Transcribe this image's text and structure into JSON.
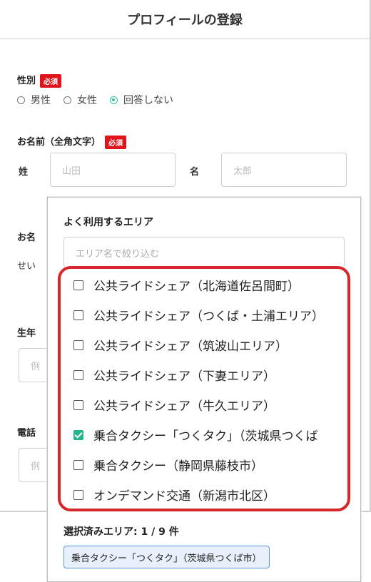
{
  "form": {
    "title": "プロフィールの登録",
    "required_label": "必須",
    "gender": {
      "label": "性別",
      "options": [
        "男性",
        "女性",
        "回答しない"
      ],
      "selected_index": 2
    },
    "name": {
      "label": "お名前（全角文字）",
      "last_label": "姓",
      "last_placeholder": "山田",
      "first_label": "名",
      "first_placeholder": "太郎"
    },
    "kana": {
      "label": "お名",
      "last_label": "せい"
    },
    "birth": {
      "label": "生年",
      "placeholder": "例"
    },
    "phone": {
      "label": "電話",
      "placeholder": "例"
    }
  },
  "area_panel": {
    "title": "よく利用するエリア",
    "filter_placeholder": "エリア名で絞り込む",
    "options": [
      {
        "label": "公共ライドシェア（北海道佐呂間町）",
        "checked": false
      },
      {
        "label": "公共ライドシェア（つくば・土浦エリア）",
        "checked": false
      },
      {
        "label": "公共ライドシェア（筑波山エリア）",
        "checked": false
      },
      {
        "label": "公共ライドシェア（下妻エリア）",
        "checked": false
      },
      {
        "label": "公共ライドシェア（牛久エリア）",
        "checked": false
      },
      {
        "label": "乗合タクシー「つくタク」（茨城県つくば",
        "checked": true
      },
      {
        "label": "乗合タクシー（静岡県藤枝市）",
        "checked": false
      },
      {
        "label": "オンデマンド交通（新潟市北区）",
        "checked": false
      }
    ],
    "selected_summary": "選択済みエリア: 1 / 9 件",
    "selected_chip": "乗合タクシー「つくタク」（茨城県つくば市）"
  },
  "colors": {
    "required": "#e1141c",
    "highlight_border": "#d7272a",
    "check_accent": "#22b58a",
    "chip_border": "#5a92d6"
  }
}
